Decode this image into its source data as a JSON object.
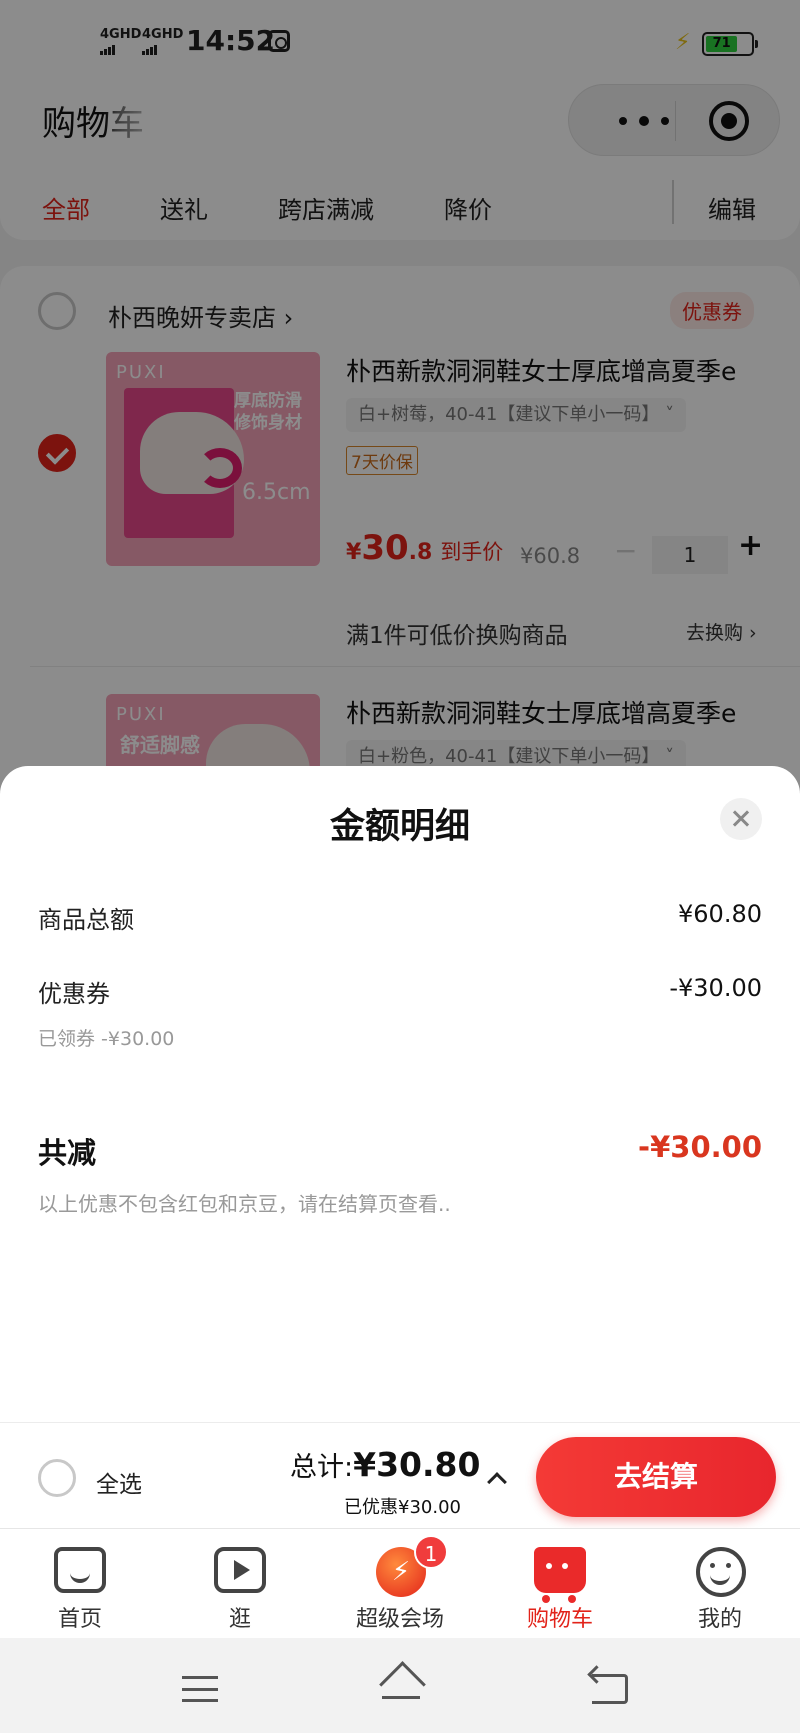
{
  "status_bar": {
    "network1": "4GHD",
    "network2": "4GHD",
    "time": "14:52",
    "battery": "71",
    "battery_level": 0.71
  },
  "header": {
    "title": "购物车",
    "tabs": [
      "全部",
      "送礼",
      "跨店满减",
      "降价"
    ],
    "edit_label": "编辑"
  },
  "store": {
    "name": "朴西晚妍专卖店",
    "arrow": "›",
    "coupon_tag": "优惠券",
    "items": [
      {
        "selected": true,
        "thumb_brand": "PUXI",
        "thumb_text": "厚底防滑修饰身材",
        "thumb_height": "6.5cm",
        "title": "朴西新款洞洞鞋女士厚底增高夏季e",
        "spec": "白+树莓，40-41【建议下单小一码】 ˅",
        "guarantee": "7天价保",
        "price_yen": "¥",
        "price_int": "30",
        "price_dec": ".8",
        "price_label": "到手价",
        "orig_price": "¥60.8",
        "minus": "−",
        "quantity": "1",
        "plus": "+",
        "tradein_text": "满1件可低价换购商品",
        "tradein_link": "去换购 ›"
      },
      {
        "selected": false,
        "thumb_brand": "PUXI",
        "thumb_text": "舒适脚感",
        "title": "朴西新款洞洞鞋女士厚底增高夏季e",
        "spec": "白+粉色，40-41【建议下单小一码】 ˅"
      }
    ]
  },
  "sheet": {
    "title": "金额明细",
    "rows": [
      {
        "label": "商品总额",
        "value": "¥60.80"
      },
      {
        "label": "优惠券",
        "value": "-¥30.00",
        "note": "已领券 -¥30.00"
      }
    ],
    "total_label": "共减",
    "total_value": "-¥30.00",
    "footnote": "以上优惠不包含红包和京豆，请在结算页查看.."
  },
  "checkout": {
    "select_all": "全选",
    "total_label": "总计:",
    "total_value": "¥30.80",
    "saved": "已优惠¥30.00",
    "button": "去结算"
  },
  "bottom_nav": {
    "items": [
      {
        "label": "首页",
        "icon": "home-icon"
      },
      {
        "label": "逛",
        "icon": "video-icon"
      },
      {
        "label": "超级会场",
        "icon": "festival-icon",
        "badge": "1"
      },
      {
        "label": "购物车",
        "icon": "cart-icon",
        "active": true
      },
      {
        "label": "我的",
        "icon": "profile-icon"
      }
    ]
  },
  "colors": {
    "accent": "#e2231a",
    "checkout_button": "#f43a36",
    "battery_fill": "#2fcf3f"
  }
}
